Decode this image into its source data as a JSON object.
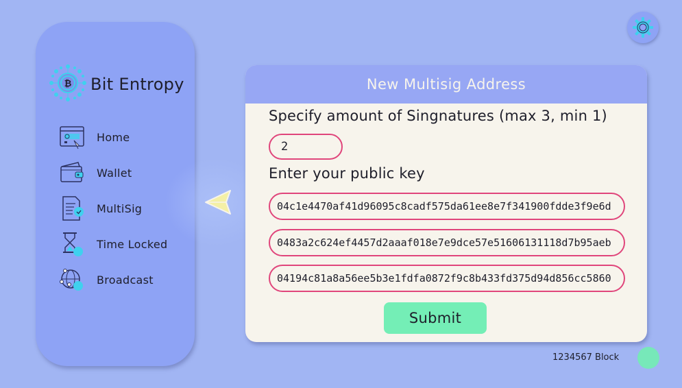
{
  "app": {
    "name": "Bit Entropy"
  },
  "sidebar": {
    "items": [
      {
        "label": "Home",
        "icon": "browser-window-icon"
      },
      {
        "label": "Wallet",
        "icon": "wallet-icon"
      },
      {
        "label": "MultiSig",
        "icon": "document-multisig-icon"
      },
      {
        "label": "Time Locked",
        "icon": "hourglass-icon"
      },
      {
        "label": "Broadcast",
        "icon": "globe-network-icon"
      }
    ]
  },
  "form": {
    "title": "New Multisig Address",
    "signatures_label": "Specify amount of Singnatures (max 3, min 1)",
    "signatures_value": "2",
    "pubkey_label": "Enter your public key",
    "keys": [
      "04c1e4470af41d96095c8cadf575da61ee8e7f341900fdde3f9e6d",
      "0483a2c624ef4457d2aaaf018e7e9dce57e51606131118d7b95aeb",
      "04194c81a8a56ee5b3e1fdfa0872f9c8b433fd375d94d856cc5860"
    ],
    "submit_label": "Submit"
  },
  "status": {
    "block_text": "1234567 Block"
  },
  "colors": {
    "background": "#a1b5f3",
    "sidebar": "#8ea3f5",
    "card": "#f7f4ec",
    "card_header": "#97a7f4",
    "input_border": "#e0457b",
    "submit": "#74eeb6",
    "status_dot": "#77e8b9",
    "icon_accent": "#3fd1ee"
  }
}
